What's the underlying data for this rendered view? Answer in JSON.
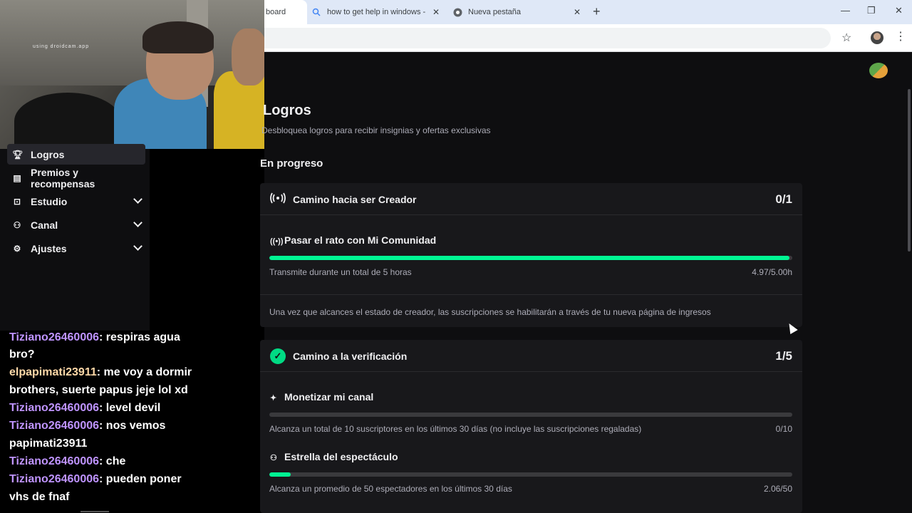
{
  "browser": {
    "tabs": [
      {
        "title": "board",
        "active": true
      },
      {
        "title": "how to get help in windows - B",
        "active": false
      },
      {
        "title": "Nueva pestaña",
        "active": false
      }
    ],
    "new_tab": "+",
    "minimize": "—",
    "maximize": "❐",
    "close": "✕"
  },
  "webcam": {
    "watermark": "using droidcam.app"
  },
  "sidebar": {
    "items": [
      {
        "label": "Logros",
        "icon": "trophy-icon",
        "active": true,
        "expandable": false
      },
      {
        "label": "Premios y recompensas",
        "icon": "gift-icon",
        "active": false,
        "expandable": false
      },
      {
        "label": "Estudio",
        "icon": "studio-icon",
        "active": false,
        "expandable": true
      },
      {
        "label": "Canal",
        "icon": "channel-icon",
        "active": false,
        "expandable": true
      },
      {
        "label": "Ajustes",
        "icon": "gear-icon",
        "active": false,
        "expandable": true
      }
    ]
  },
  "chat": {
    "messages": [
      {
        "user": "Tiziano26460006",
        "text": "respiras agua"
      },
      {
        "user": "",
        "text": "bro?"
      },
      {
        "user": "elpapimati23911",
        "text": "me voy a dormir"
      },
      {
        "user": "",
        "text": "brothers, suerte papus jeje lol xd"
      },
      {
        "user": "Tiziano26460006",
        "text": "level devil"
      },
      {
        "user": "Tiziano26460006",
        "text": "nos vemos"
      },
      {
        "user": "",
        "text": "papimati23911"
      },
      {
        "user": "Tiziano26460006",
        "text": "che"
      },
      {
        "user": "Tiziano26460006",
        "text": "pueden poner"
      },
      {
        "user": "",
        "text": "vhs de fnaf"
      }
    ]
  },
  "main": {
    "title": "Logros",
    "subtitle": "Desbloquea logros para recibir insignias y ofertas exclusivas",
    "section": "En progreso",
    "cards": [
      {
        "title": "Camino hacia ser Creador",
        "count": "0/1",
        "tasks": [
          {
            "title": "Pasar el rato con Mi Comunidad",
            "progress": 0.994,
            "desc": "Transmite durante un total de 5 horas",
            "value": "4.97/5.00h"
          }
        ],
        "note": "Una vez que alcances el estado de creador, las suscripciones se habilitarán a través de tu nueva página de ingresos"
      },
      {
        "title": "Camino a la verificación",
        "count": "1/5",
        "tasks": [
          {
            "title": "Monetizar mi canal",
            "progress": 0.0,
            "desc": "Alcanza un total de 10 suscriptores en los últimos 30 días (no incluye las suscripciones regaladas)",
            "value": "0/10"
          },
          {
            "title": "Estrella del espectáculo",
            "progress": 0.0412,
            "desc": "Alcanza un promedio de 50 espectadores en los últimos 30 días",
            "value": "2.06/50"
          }
        ]
      }
    ]
  },
  "colors": {
    "accent_green": "#00f593",
    "badge_green": "#00db84",
    "chat_username": "#bf94ff",
    "chat_username_alt": "#ffd9a8",
    "background": "#0e0e10",
    "card": "#18181b"
  }
}
